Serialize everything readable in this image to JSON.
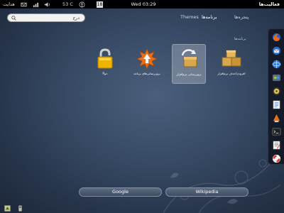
{
  "top_panel": {
    "help_label": "هدایت",
    "temperature": "53 C",
    "calendar_day": "18",
    "clock": "Wed 03:29",
    "activities_label": "فعالیت‌ها"
  },
  "search": {
    "value": "درج"
  },
  "view_tabs": {
    "themes": "Themes",
    "applications": "برنامه‌ها",
    "windows": "پنجره‌ها"
  },
  "section_label": "برنامه‌ها",
  "apps": [
    {
      "label": "Pحو",
      "icon": "padlock-icon"
    },
    {
      "label": "بروزرسانی‌های برنامه",
      "icon": "update-star-icon"
    },
    {
      "label": "بروزرسانی‌ نرم‌افزار",
      "icon": "software-update-icon"
    },
    {
      "label": "افزودن/حذف نرم‌افزار",
      "icon": "package-manager-icon"
    }
  ],
  "dash_items": [
    "firefox-icon",
    "thunderbird-icon",
    "web-browser-icon",
    "chat-icon",
    "media-icon",
    "document-icon",
    "player-icon",
    "terminal-icon",
    "text-editor-icon",
    "help-icon"
  ],
  "search_providers": {
    "google": "Google",
    "wikipedia": "Wikipedia"
  },
  "tray_icons": [
    "notification-icon",
    "usb-icon"
  ],
  "colors": {
    "panel": "#000000",
    "background": "#3a4d68",
    "selection": "#c8cdd7"
  }
}
